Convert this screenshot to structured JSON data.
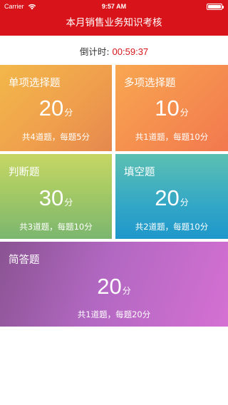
{
  "status_bar": {
    "carrier": "Carrier",
    "time": "9:57 AM",
    "wifi_icon": "wifi-icon",
    "battery_icon": "battery-icon",
    "battery_level": 1.0
  },
  "nav": {
    "title": "本月销售业务知识考核"
  },
  "countdown": {
    "label": "倒计时:",
    "value": "00:59:37"
  },
  "cards": {
    "single": {
      "title": "单项选择题",
      "score": "20",
      "unit": "分",
      "desc": "共4道题，每题5分"
    },
    "multi": {
      "title": "多项选择题",
      "score": "10",
      "unit": "分",
      "desc": "共1道题，每题10分"
    },
    "judge": {
      "title": "判断题",
      "score": "30",
      "unit": "分",
      "desc": "共3道题，每题10分"
    },
    "fill": {
      "title": "填空题",
      "score": "20",
      "unit": "分",
      "desc": "共2道题，每题10分"
    },
    "short": {
      "title": "简答题",
      "score": "20",
      "unit": "分",
      "desc": "共1道题，每题20分"
    }
  },
  "colors": {
    "brand_red": "#d8141a",
    "countdown_text": "#d8141a"
  }
}
